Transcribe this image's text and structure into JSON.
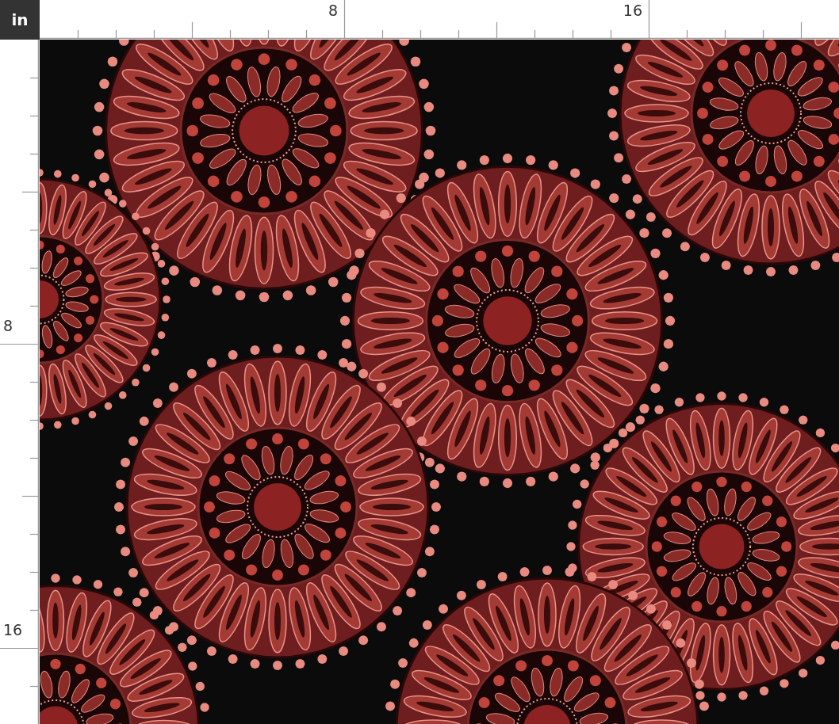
{
  "unit": "in",
  "top_ruler": {
    "labels": [
      "8",
      "16"
    ]
  },
  "left_ruler": {
    "labels": [
      "8",
      "16"
    ]
  }
}
